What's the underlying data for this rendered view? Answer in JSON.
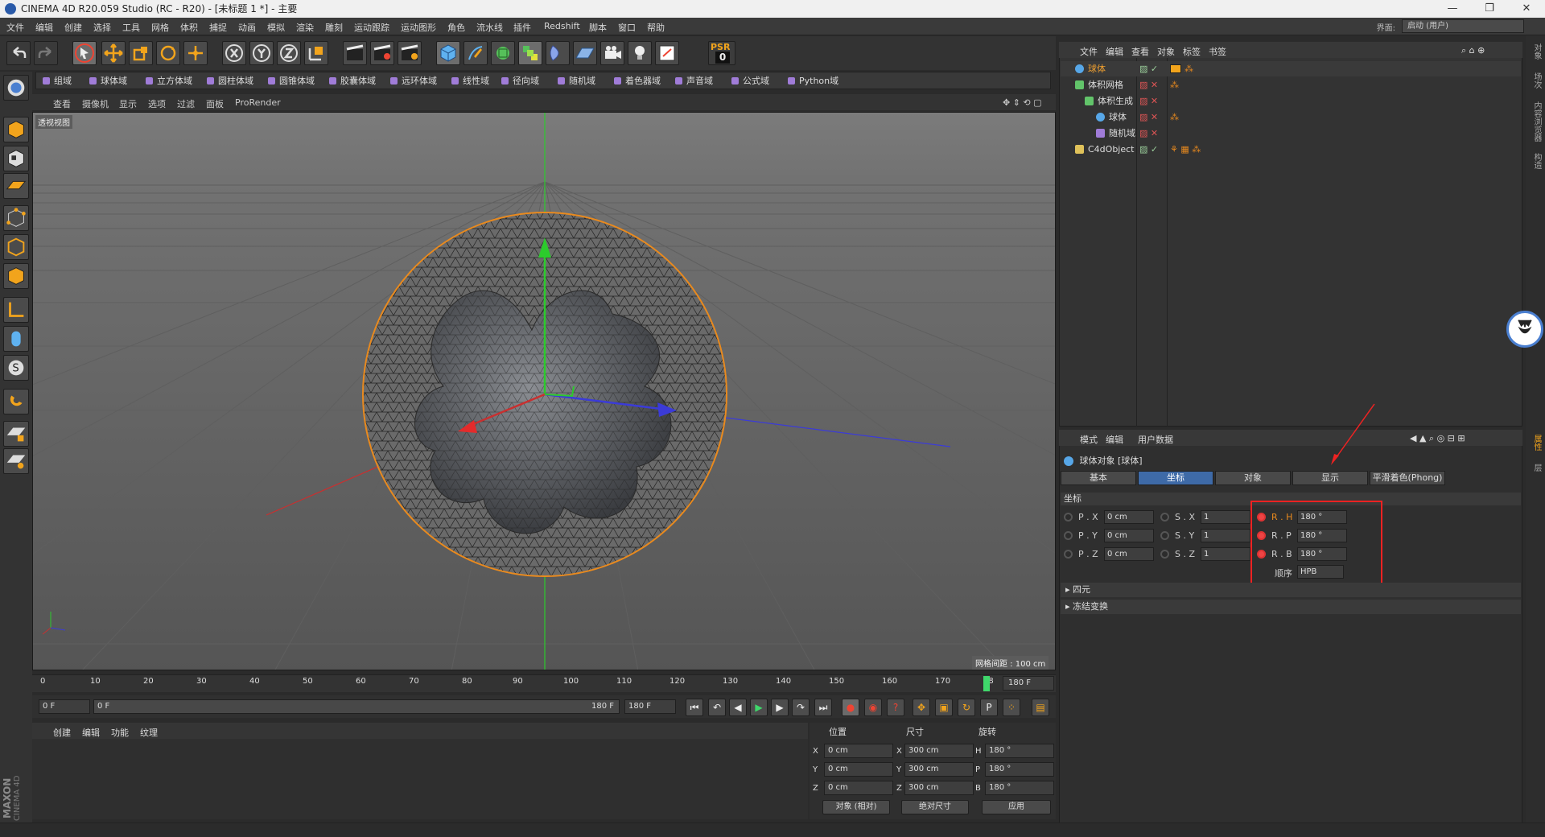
{
  "titlebar": {
    "title": "CINEMA 4D R20.059 Studio (RC - R20) - [未标题 1 *] - 主要"
  },
  "menubar": {
    "items": [
      "文件",
      "编辑",
      "创建",
      "选择",
      "工具",
      "网格",
      "体积",
      "捕捉",
      "动画",
      "模拟",
      "渲染",
      "雕刻",
      "运动跟踪",
      "运动图形",
      "角色",
      "流水线",
      "插件",
      "Redshift",
      "脚本",
      "窗口",
      "帮助"
    ],
    "layout_label": "界面:",
    "layout_value": "启动 (用户)"
  },
  "domainbar": {
    "items": [
      "组域",
      "球体域",
      "立方体域",
      "圆柱体域",
      "圆锥体域",
      "胶囊体域",
      "远环体域",
      "线性域",
      "径向域",
      "随机域",
      "着色器域",
      "声音域",
      "公式域",
      "Python域"
    ]
  },
  "viewport": {
    "menu": [
      "查看",
      "摄像机",
      "显示",
      "选项",
      "过滤",
      "面板",
      "ProRender"
    ],
    "label": "透视视图",
    "grid_info": "网格间距 : 100 cm"
  },
  "timeline": {
    "ticks": [
      "0",
      "10",
      "20",
      "30",
      "40",
      "50",
      "60",
      "70",
      "80",
      "90",
      "100",
      "110",
      "120",
      "130",
      "140",
      "150",
      "160",
      "170",
      "18"
    ],
    "end_frame": "180 F",
    "current": 180,
    "max": 180
  },
  "playbar": {
    "start": "0 F",
    "range_start": "0 F",
    "range_end": "180 F",
    "end": "180 F",
    "psr": "PSR",
    "psr_val": "0"
  },
  "material": {
    "menu": [
      "创建",
      "编辑",
      "功能",
      "纹理"
    ],
    "brand1": "MAXON",
    "brand2": "CINEMA 4D"
  },
  "coords": {
    "headers": [
      "位置",
      "尺寸",
      "旋转"
    ],
    "rows": [
      {
        "axis": "X",
        "pos": "0 cm",
        "size_axis": "X",
        "size": "300 cm",
        "rot_axis": "H",
        "rot": "180 °"
      },
      {
        "axis": "Y",
        "pos": "0 cm",
        "size_axis": "Y",
        "size": "300 cm",
        "rot_axis": "P",
        "rot": "180 °"
      },
      {
        "axis": "Z",
        "pos": "0 cm",
        "size_axis": "Z",
        "size": "300 cm",
        "rot_axis": "B",
        "rot": "180 °"
      }
    ],
    "mode": "对象 (相对)",
    "size_mode": "绝对尺寸",
    "apply": "应用"
  },
  "objects": {
    "menu": [
      "文件",
      "编辑",
      "查看",
      "对象",
      "标签",
      "书签"
    ],
    "rows": [
      {
        "name": "球体",
        "indent": 0,
        "color": "#f0a030"
      },
      {
        "name": "体积网格",
        "indent": 0,
        "color": "#dddddd"
      },
      {
        "name": "体积生成",
        "indent": 1,
        "color": "#dddddd"
      },
      {
        "name": "球体",
        "indent": 2,
        "color": "#dddddd"
      },
      {
        "name": "随机域",
        "indent": 2,
        "color": "#dddddd"
      },
      {
        "name": "C4dObject",
        "indent": 0,
        "color": "#dddddd"
      }
    ]
  },
  "attributes": {
    "menu": [
      "模式",
      "编辑",
      "用户数据"
    ],
    "title": "球体对象 [球体]",
    "tabs": [
      "基本",
      "坐标",
      "对象",
      "显示",
      "平滑着色(Phong)"
    ],
    "active_tab": 1,
    "section": "坐标",
    "pos": [
      {
        "label": "P . X",
        "value": "0 cm"
      },
      {
        "label": "P . Y",
        "value": "0 cm"
      },
      {
        "label": "P . Z",
        "value": "0 cm"
      }
    ],
    "scale": [
      {
        "label": "S . X",
        "value": "1"
      },
      {
        "label": "S . Y",
        "value": "1"
      },
      {
        "label": "S . Z",
        "value": "1"
      }
    ],
    "rot": [
      {
        "label": "R . H",
        "value": "180 °"
      },
      {
        "label": "R . P",
        "value": "180 °"
      },
      {
        "label": "R . B",
        "value": "180 °"
      }
    ],
    "order_label": "顺序",
    "order_value": "HPB",
    "collapsed": [
      "四元",
      "冻结变换"
    ]
  },
  "rightstrip": {
    "labels": [
      "对象",
      "场次",
      "内容浏览器",
      "构造",
      "属性",
      "层"
    ]
  },
  "colors": {
    "accent": "#3e6aa7",
    "highlight_box": "#e22222",
    "object_selected": "#f0a030"
  }
}
